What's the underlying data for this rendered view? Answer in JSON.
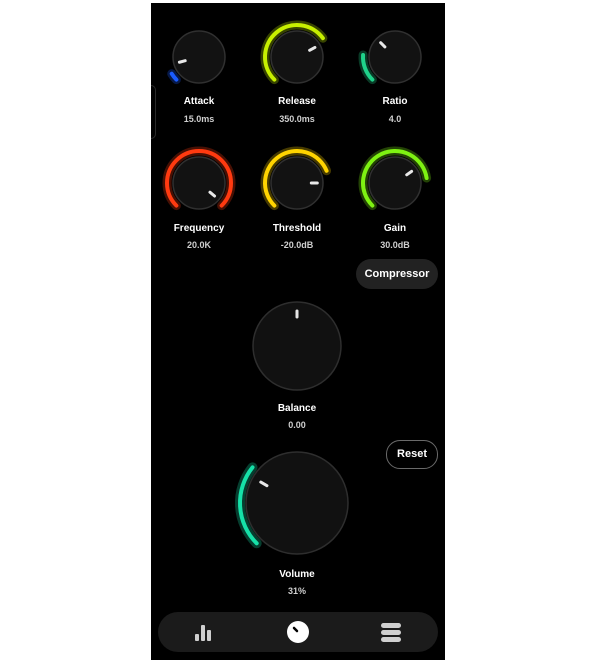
{
  "knobs": [
    {
      "id": "attack",
      "label": "Attack",
      "value": "15.0ms",
      "color": "#1a5bff",
      "level": 0.05,
      "knob_angle": 255
    },
    {
      "id": "release",
      "label": "Release",
      "value": "350.0ms",
      "color": "#c7f000",
      "level": 0.7,
      "knob_angle": 62
    },
    {
      "id": "ratio",
      "label": "Ratio",
      "value": "4.0",
      "color": "#1fd28a",
      "level": 0.18,
      "knob_angle": -45
    },
    {
      "id": "frequency",
      "label": "Frequency",
      "value": "20.0K",
      "color": "#ff3a10",
      "level": 1.0,
      "knob_angle": 130
    },
    {
      "id": "threshold",
      "label": "Threshold",
      "value": "-20.0dB",
      "color": "#ffd400",
      "level": 0.75,
      "knob_angle": 90
    },
    {
      "id": "gain",
      "label": "Gain",
      "value": "30.0dB",
      "color": "#7ef212",
      "level": 0.8,
      "knob_angle": 55
    }
  ],
  "balance": {
    "label": "Balance",
    "value": "0.00"
  },
  "volume": {
    "label": "Volume",
    "value": "31%",
    "color": "#16e0a8",
    "level": 0.31
  },
  "buttons": {
    "compressor": "Compressor",
    "reset": "Reset"
  },
  "nav": {
    "items": [
      {
        "icon": "bars-chart-icon"
      },
      {
        "icon": "knob-icon"
      },
      {
        "icon": "menu-list-icon"
      }
    ]
  }
}
